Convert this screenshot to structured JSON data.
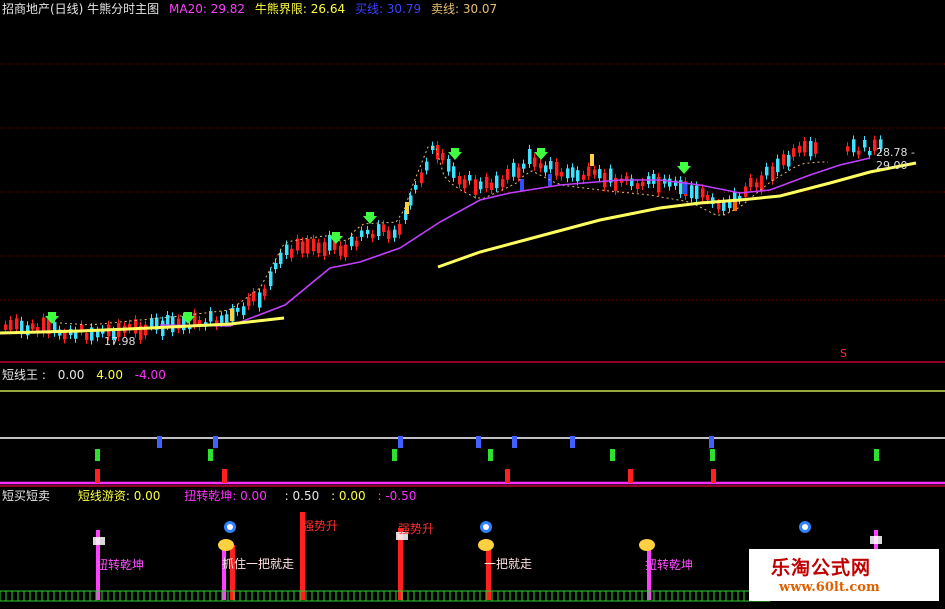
{
  "header": {
    "title": "招商地产(日线) 牛熊分时主图",
    "ma20_label": "MA20: 29.82",
    "bull_bear_label": "牛熊界限: 26.64",
    "buy_label": "买线: 30.79",
    "sell_label": "卖线: 30.07"
  },
  "main_chart": {
    "high_tag": "28.78 - 29.00",
    "low_tag": "17.98",
    "s_marker": "S"
  },
  "pane2": {
    "title": "短线王 :",
    "v1": "0.00",
    "v2": "4.00",
    "v3": "-4.00"
  },
  "pane3": {
    "title": "短买短卖",
    "label1": "短线游资: 0.00",
    "label2": "扭转乾坤: 0.00",
    "v1": ": 0.50",
    "v2": ": 0.00",
    "v3": ": -0.50"
  },
  "signals": {
    "s1": "扭转乾坤",
    "s2": "扭转乾坤",
    "s3": "强势升",
    "s4": "强势升",
    "s5": "抓住一把就走",
    "s6": "一把就走"
  },
  "watermark": {
    "site_name": "乐淘公式网",
    "url": "www.60lt.com"
  },
  "colors": {
    "bull_candle": "#ff2020",
    "bear_candle": "#40e0ff",
    "ma20": "#c040ff",
    "bull_bear_line": "#ffff40",
    "pane_line": "#c00030"
  }
}
